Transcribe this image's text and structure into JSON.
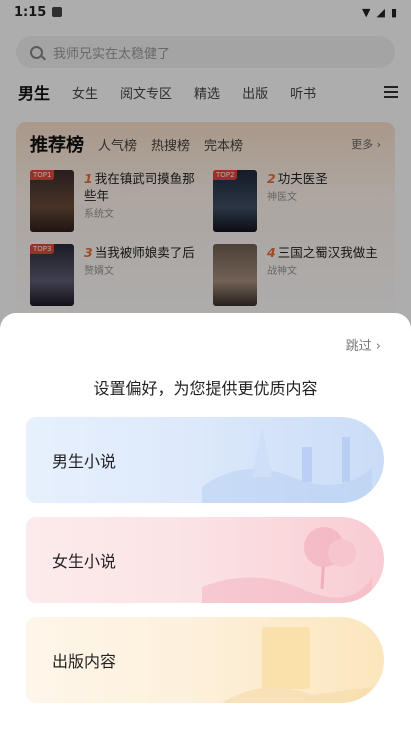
{
  "status_bar": {
    "time": "1:15"
  },
  "search": {
    "placeholder": "我师兄实在太稳健了"
  },
  "tabs": [
    "男生",
    "女生",
    "阅文专区",
    "精选",
    "出版",
    "听书"
  ],
  "ranking": {
    "title": "推荐榜",
    "subtabs": [
      "人气榜",
      "热搜榜",
      "完本榜"
    ],
    "more": "更多",
    "books": [
      {
        "rank": "1",
        "tag": "TOP1",
        "title": "我在镇武司摸鱼那些年",
        "category": "系统文"
      },
      {
        "rank": "2",
        "tag": "TOP2",
        "title": "功夫医圣",
        "category": "神医文"
      },
      {
        "rank": "3",
        "tag": "TOP3",
        "title": "当我被师娘卖了后",
        "category": "赘婿文"
      },
      {
        "rank": "4",
        "tag": "",
        "title": "三国之蜀汉我做主",
        "category": "战神文"
      }
    ]
  },
  "sheet": {
    "skip": "跳过",
    "title": "设置偏好，为您提供更优质内容",
    "options": {
      "male": "男生小说",
      "female": "女生小说",
      "publish": "出版内容"
    }
  }
}
